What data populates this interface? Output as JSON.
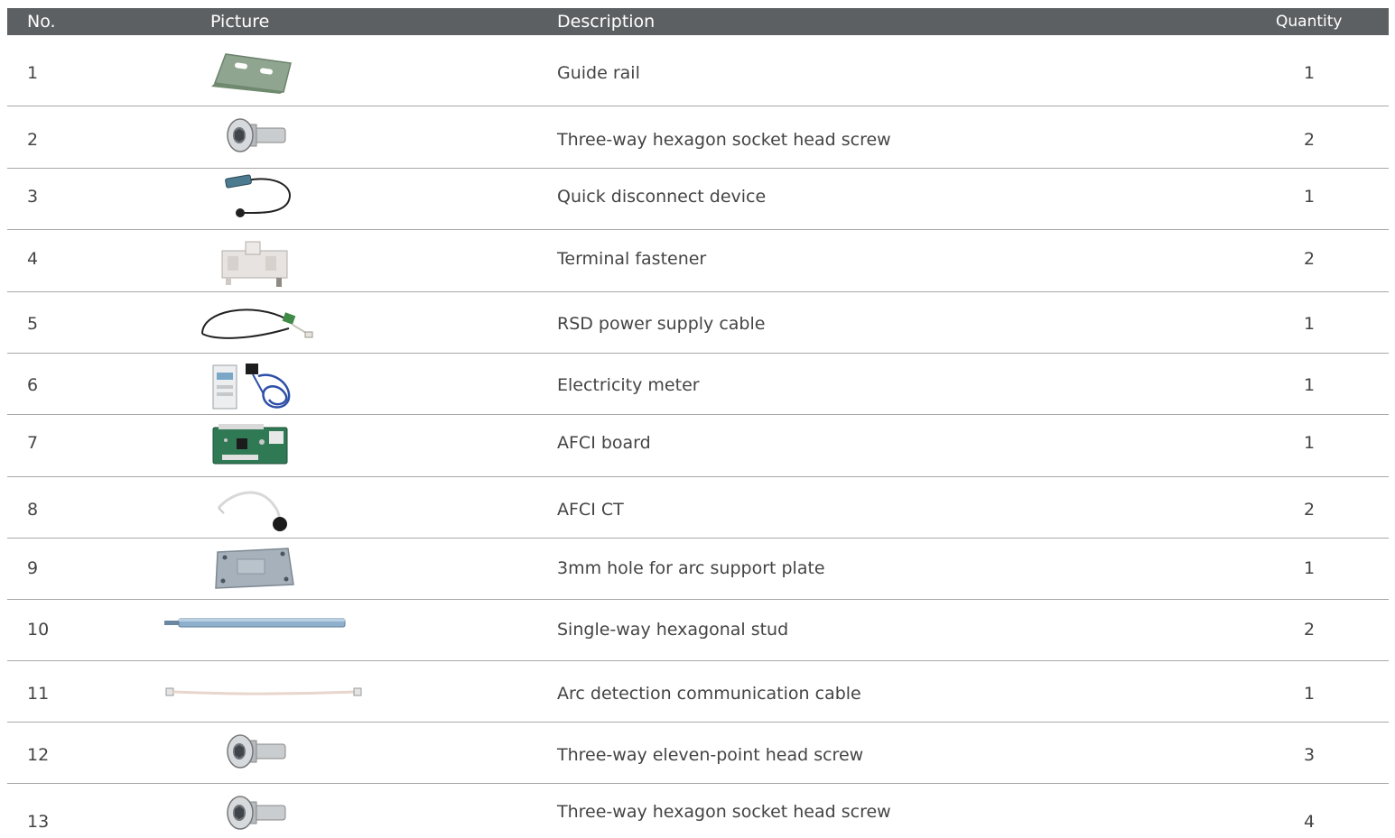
{
  "header": {
    "no": "No.",
    "picture": "Picture",
    "description": "Description",
    "quantity": "Quantity"
  },
  "rows": [
    {
      "no": "1",
      "icon": "guide-rail-icon",
      "description": "Guide rail",
      "quantity": "1"
    },
    {
      "no": "2",
      "icon": "hex-socket-screw-icon",
      "description": "Three-way hexagon socket head screw",
      "quantity": "2"
    },
    {
      "no": "3",
      "icon": "quick-disconnect-device-icon",
      "description": "Quick disconnect device",
      "quantity": "1"
    },
    {
      "no": "4",
      "icon": "terminal-fastener-icon",
      "description": "Terminal fastener",
      "quantity": "2"
    },
    {
      "no": "5",
      "icon": "power-cable-icon",
      "description": "RSD power supply cable",
      "quantity": "1"
    },
    {
      "no": "6",
      "icon": "electricity-meter-icon",
      "description": "Electricity meter",
      "quantity": "1"
    },
    {
      "no": "7",
      "icon": "circuit-board-icon",
      "description": "AFCI board",
      "quantity": "1"
    },
    {
      "no": "8",
      "icon": "ct-sensor-icon",
      "description": "AFCI CT",
      "quantity": "2"
    },
    {
      "no": "9",
      "icon": "support-plate-icon",
      "description": "3mm hole for arc support plate",
      "quantity": "1"
    },
    {
      "no": "10",
      "icon": "hex-stud-icon",
      "description": "Single-way hexagonal stud",
      "quantity": "2"
    },
    {
      "no": "11",
      "icon": "communication-cable-icon",
      "description": "Arc detection communication cable",
      "quantity": "1"
    },
    {
      "no": "12",
      "icon": "hex-socket-screw-icon",
      "description": "Three-way eleven-point head screw",
      "quantity": "3"
    },
    {
      "no": "13",
      "icon": "hex-socket-screw-icon",
      "description": "Three-way hexagon socket head screw",
      "quantity": "4"
    }
  ]
}
